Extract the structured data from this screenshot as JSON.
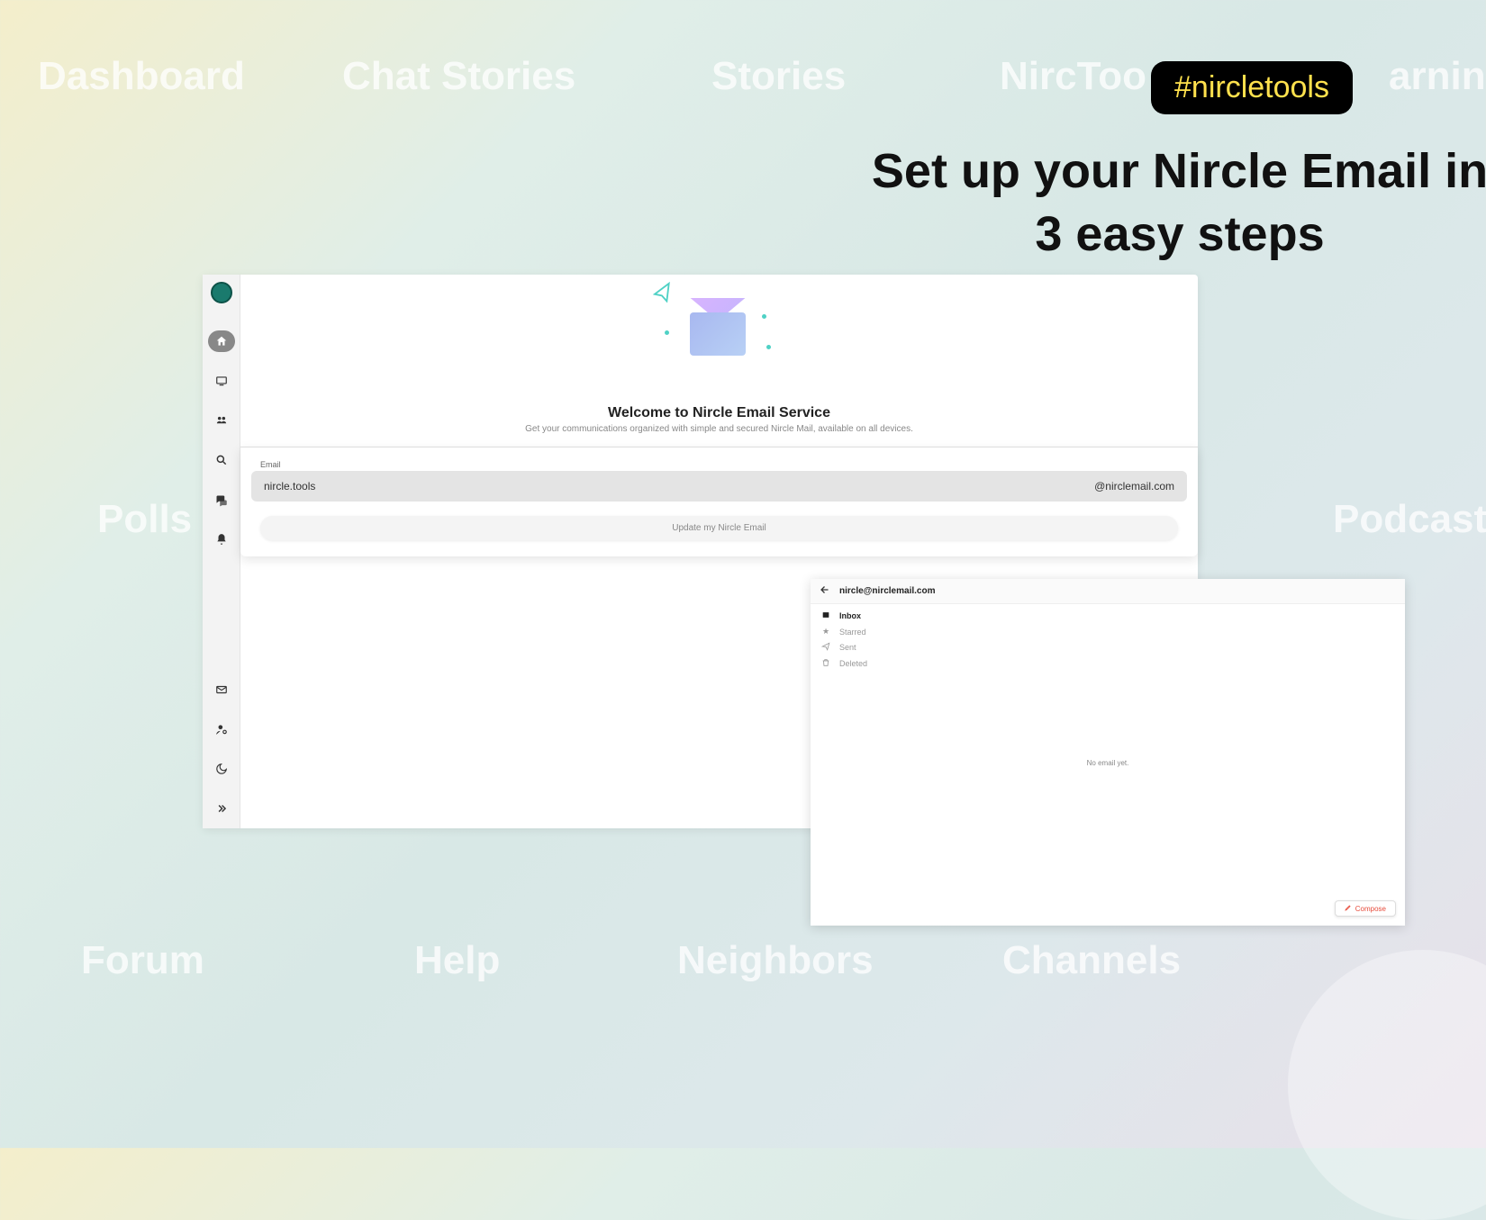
{
  "hashtag": "#nircletools",
  "headline": "Set up your Nircle Email in 3 easy steps",
  "bg_labels": {
    "dashboard": "Dashboard",
    "chat_stories": "Chat Stories",
    "stories": "Stories",
    "nirctoo": "NircToo",
    "arning": "arning",
    "polls": "Polls",
    "podcast": "Podcast",
    "forum": "Forum",
    "help": "Help",
    "neighbors": "Neighbors",
    "channels": "Channels"
  },
  "panel1": {
    "welcome_title": "Welcome to Nircle Email Service",
    "welcome_sub": "Get your communications organized with simple and secured Nircle Mail, available on all devices.",
    "email_label": "Email",
    "email_value": "nircle.tools",
    "email_suffix": "@nirclemail.com",
    "update_button": "Update my Nircle Email"
  },
  "panel2": {
    "email_address": "nircle@nirclemail.com",
    "folders": {
      "inbox": "Inbox",
      "starred": "Starred",
      "sent": "Sent",
      "deleted": "Deleted"
    },
    "empty_text": "No email yet.",
    "compose": "Compose"
  }
}
